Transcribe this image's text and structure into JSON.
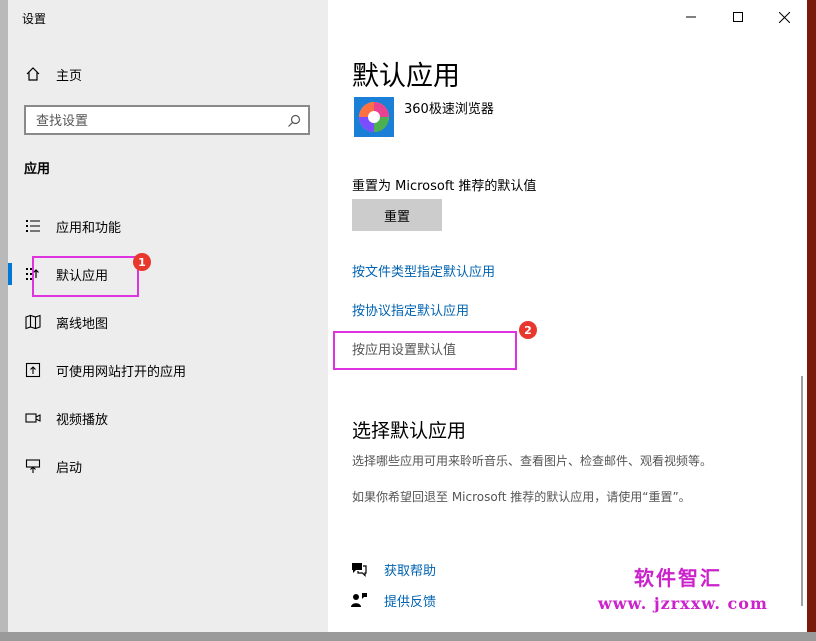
{
  "window": {
    "title": "设置"
  },
  "controls": {
    "minimize": "—",
    "maximize": "☐",
    "close": "✕"
  },
  "sidebar": {
    "home_label": "主页",
    "search_placeholder": "查找设置",
    "section_label": "应用",
    "items": [
      {
        "label": "应用和功能",
        "icon": "apps-features-icon"
      },
      {
        "label": "默认应用",
        "icon": "default-apps-icon"
      },
      {
        "label": "离线地图",
        "icon": "offline-maps-icon"
      },
      {
        "label": "可使用网站打开的应用",
        "icon": "apps-for-websites-icon"
      },
      {
        "label": "视频播放",
        "icon": "video-playback-icon"
      },
      {
        "label": "启动",
        "icon": "startup-icon"
      }
    ]
  },
  "annotations": {
    "badge1": "1",
    "badge2": "2",
    "color": "#e033e0",
    "badge_color": "#e8372c"
  },
  "content": {
    "title": "默认应用",
    "app_name": "360极速浏览器",
    "reset_caption": "重置为 Microsoft 推荐的默认值",
    "reset_button": "重置",
    "link_file_type": "按文件类型指定默认应用",
    "link_protocol": "按协议指定默认应用",
    "link_by_app": "按应用设置默认值",
    "choose_title": "选择默认应用",
    "choose_desc": "选择哪些应用可用来聆听音乐、查看图片、检查邮件、观看视频等。",
    "reset_desc": "如果你希望回退至 Microsoft 推荐的默认应用，请使用“重置”。",
    "help_label": "获取帮助",
    "feedback_label": "提供反馈"
  },
  "watermark": {
    "line1": "软件智汇",
    "line2": "www. jzrxxw. com"
  },
  "colors": {
    "accent": "#0078d7",
    "link": "#0063b1",
    "sidebar_bg": "#ededed"
  }
}
